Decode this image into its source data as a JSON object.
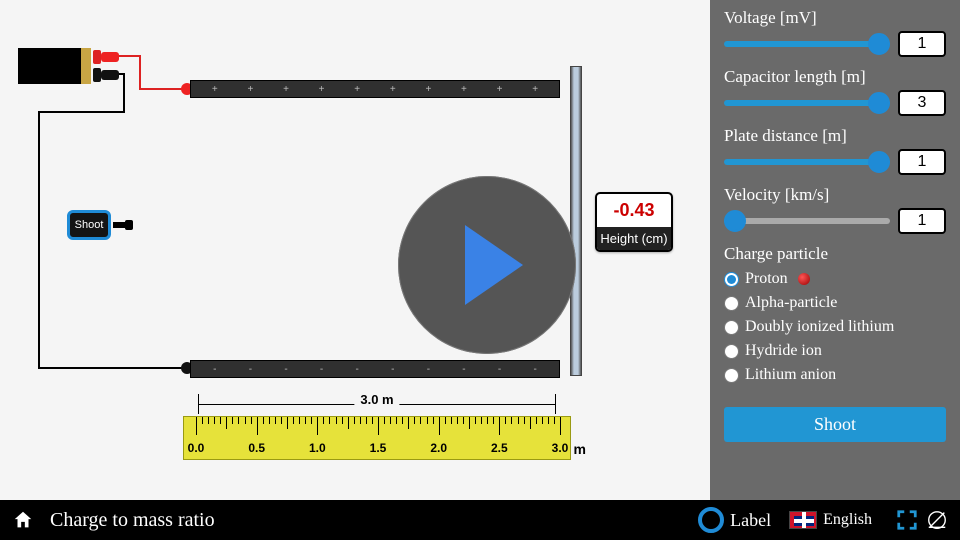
{
  "title": "Charge to mass ratio",
  "sidebar": {
    "voltage": {
      "label": "Voltage [mV]",
      "value": "1"
    },
    "length": {
      "label": "Capacitor length [m]",
      "value": "3"
    },
    "distance": {
      "label": "Plate distance [m]",
      "value": "1"
    },
    "velocity": {
      "label": "Velocity [km/s]",
      "value": "1"
    },
    "particle": {
      "label": "Charge particle",
      "options": {
        "proton": "Proton",
        "alpha": "Alpha-particle",
        "lithium2": "Doubly ionized lithium",
        "hydride": "Hydride ion",
        "lianion": "Lithium anion"
      },
      "selected": "proton"
    },
    "shoot_btn": "Shoot"
  },
  "stage": {
    "shoot_box_label": "Shoot",
    "plate_signs_top": [
      "+",
      "+",
      "+",
      "+",
      "+",
      "+",
      "+",
      "+",
      "+",
      "+"
    ],
    "plate_signs_bot": [
      "-",
      "-",
      "-",
      "-",
      "-",
      "-",
      "-",
      "-",
      "-",
      "-"
    ],
    "height_value": "-0.43",
    "height_label": "Height (cm)",
    "caliper_label": "3.0 m",
    "ruler": {
      "ticks": [
        "0.0",
        "0.5",
        "1.0",
        "1.5",
        "2.0",
        "2.5",
        "3.0"
      ],
      "unit": "m"
    }
  },
  "bottombar": {
    "label_toggle": "Label",
    "language": "English"
  }
}
